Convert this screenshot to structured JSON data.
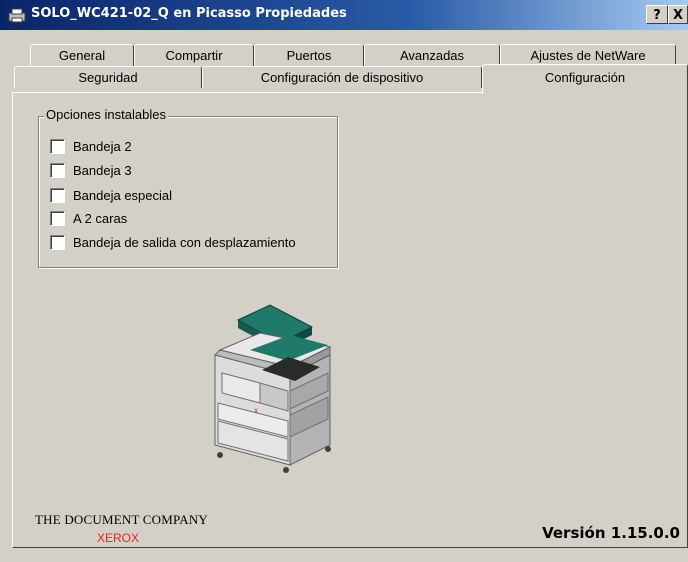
{
  "window": {
    "title": "SOLO_WC421-02_Q en Picasso Propiedades",
    "help_label": "?",
    "close_label": "X"
  },
  "tabs_row1": [
    "General",
    "Compartir",
    "Puertos",
    "Avanzadas",
    "Ajustes de NetWare"
  ],
  "tabs_row2": [
    "Seguridad",
    "Configuración de dispositivo",
    "Configuración"
  ],
  "active_tab": "Configuración",
  "options": {
    "group_title": "Opciones instalables",
    "items": [
      {
        "label": "Bandeja 2",
        "checked": false
      },
      {
        "label": "Bandeja 3",
        "checked": false
      },
      {
        "label": "Bandeja especial",
        "checked": false
      },
      {
        "label": "A 2 caras",
        "checked": false
      },
      {
        "label": "Bandeja de salida con desplazamiento",
        "checked": false
      }
    ]
  },
  "footer": {
    "company": "THE DOCUMENT COMPANY",
    "brand": "XEROX",
    "version": "Versión 1.15.0.0"
  },
  "colors": {
    "titlebar": "#0a246a",
    "dialog": "#d4d0c8",
    "printer_accent": "#1f7a6b",
    "brand_red": "#e8201c"
  }
}
